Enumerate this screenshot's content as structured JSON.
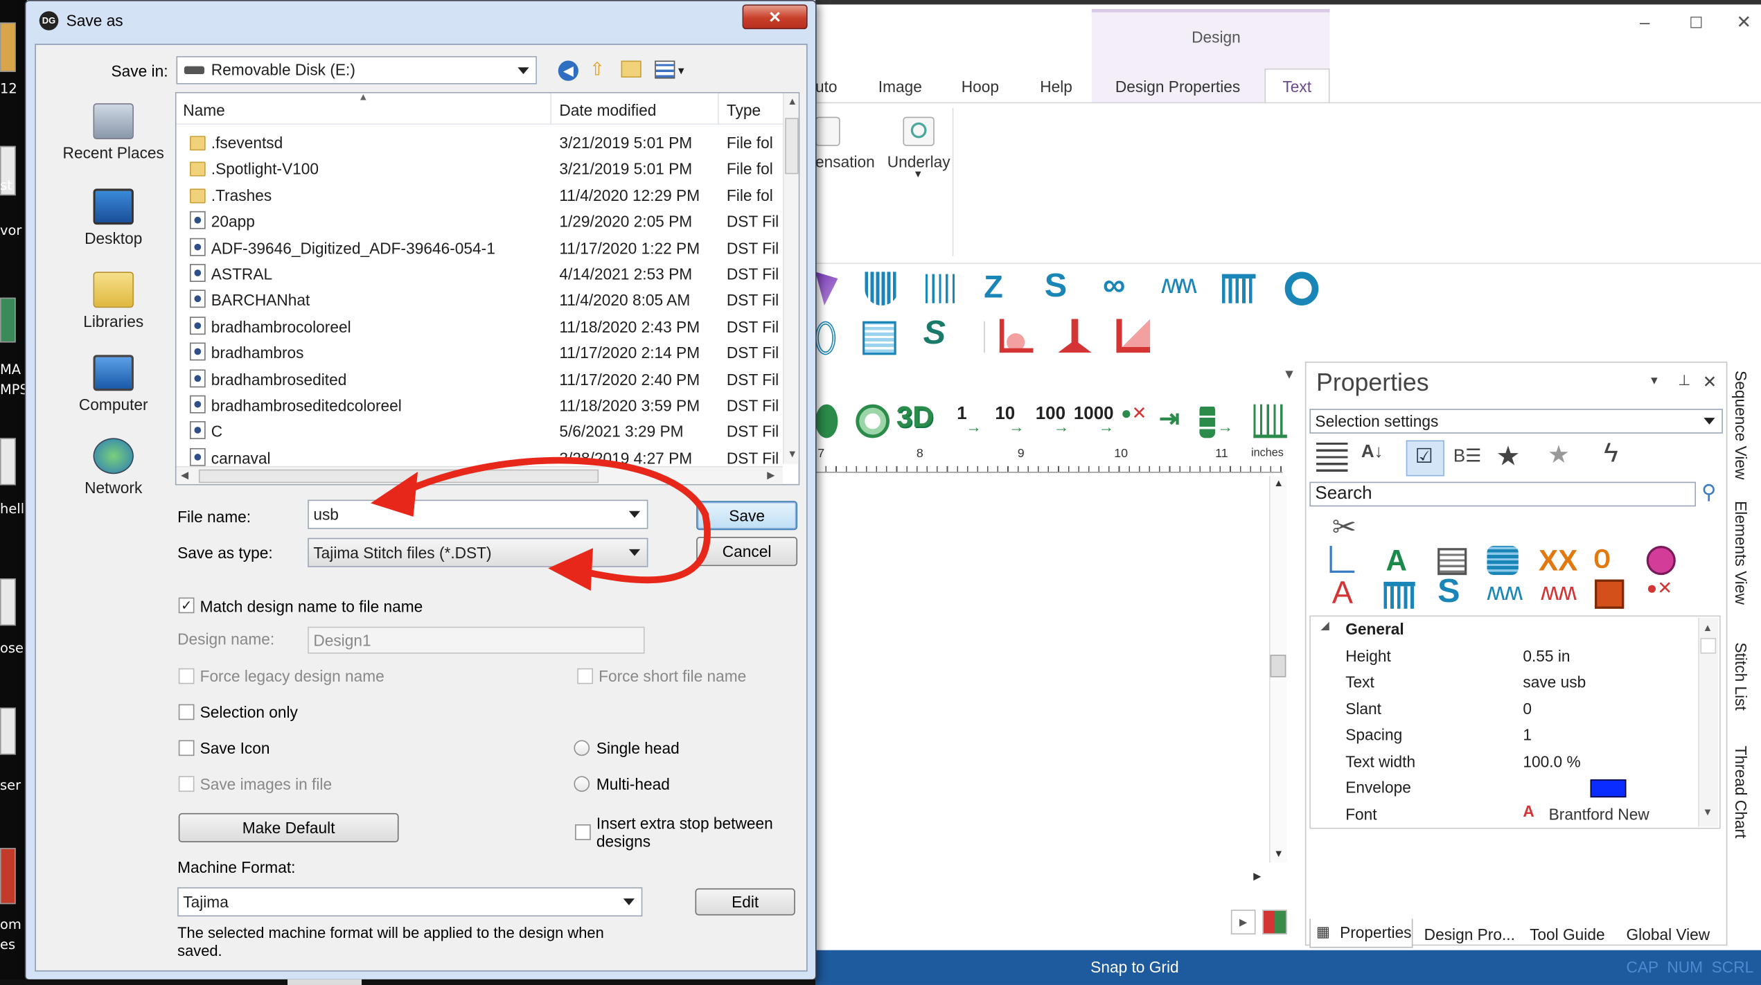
{
  "desktop": {
    "fragments": [
      "12",
      "st",
      "vor",
      "MA",
      "MPS",
      "hell",
      "ose",
      "ser",
      "om",
      "es"
    ]
  },
  "dialog": {
    "title": "Save as",
    "close_glyph": "✕",
    "save_in_label": "Save in:",
    "save_in_value": "Removable Disk (E:)",
    "places": [
      "Recent Places",
      "Desktop",
      "Libraries",
      "Computer",
      "Network"
    ],
    "columns": {
      "name": "Name",
      "date": "Date modified",
      "type": "Type"
    },
    "files": [
      {
        "name": ".fseventsd",
        "date": "3/21/2019 5:01 PM",
        "type": "File fol",
        "kind": "folder"
      },
      {
        "name": ".Spotlight-V100",
        "date": "3/21/2019 5:01 PM",
        "type": "File fol",
        "kind": "folder"
      },
      {
        "name": ".Trashes",
        "date": "11/4/2020 12:29 PM",
        "type": "File fol",
        "kind": "folder"
      },
      {
        "name": "20app",
        "date": "1/29/2020 2:05 PM",
        "type": "DST Fil",
        "kind": "doc"
      },
      {
        "name": "ADF-39646_Digitized_ADF-39646-054-1",
        "date": "11/17/2020 1:22 PM",
        "type": "DST Fil",
        "kind": "doc"
      },
      {
        "name": "ASTRAL",
        "date": "4/14/2021 2:53 PM",
        "type": "DST Fil",
        "kind": "doc"
      },
      {
        "name": "BARCHANhat",
        "date": "11/4/2020 8:05 AM",
        "type": "DST Fil",
        "kind": "doc"
      },
      {
        "name": "bradhambrocoloreel",
        "date": "11/18/2020 2:43 PM",
        "type": "DST Fil",
        "kind": "doc"
      },
      {
        "name": "bradhambros",
        "date": "11/17/2020 2:14 PM",
        "type": "DST Fil",
        "kind": "doc"
      },
      {
        "name": "bradhambrosedited",
        "date": "11/17/2020 2:40 PM",
        "type": "DST Fil",
        "kind": "doc"
      },
      {
        "name": "bradhambroseditedcoloreel",
        "date": "11/18/2020 3:59 PM",
        "type": "DST Fil",
        "kind": "doc"
      },
      {
        "name": "C",
        "date": "5/6/2021 3:29 PM",
        "type": "DST Fil",
        "kind": "doc"
      },
      {
        "name": "carnaval",
        "date": "3/28/2019 4:27 PM",
        "type": "DST Fil",
        "kind": "doc"
      }
    ],
    "file_name_label": "File name:",
    "file_name_value": "usb",
    "save_type_label": "Save as type:",
    "save_type_value": "Tajima Stitch files (*.DST)",
    "save_button": "Save",
    "cancel_button": "Cancel",
    "match_design_name": "Match design name to file name",
    "design_name_label": "Design name:",
    "design_name_value": "Design1",
    "force_legacy": "Force legacy design name",
    "force_short": "Force short file name",
    "selection_only": "Selection only",
    "save_icon": "Save Icon",
    "single_head": "Single head",
    "save_images": "Save images in file",
    "multi_head": "Multi-head",
    "make_default": "Make Default",
    "insert_stop_1": "Insert extra stop between",
    "insert_stop_2": "designs",
    "machine_format_label": "Machine Format:",
    "machine_format_value": "Tajima",
    "edit_button": "Edit",
    "footer_note_1": "The selected machine format will be applied to the design when",
    "footer_note_2": "saved."
  },
  "ribbon": {
    "context_group": "Design",
    "tabs": [
      "uto",
      "Image",
      "Hoop",
      "Help",
      "Design Properties",
      "Text"
    ],
    "buttons": [
      "ensation",
      "Underlay"
    ]
  },
  "toolbar": {
    "counts": [
      "1",
      "10",
      "100",
      "1000"
    ],
    "three_d": "3D"
  },
  "ruler": {
    "ticks": [
      "7",
      "8",
      "9",
      "10",
      "11"
    ],
    "unit": "inches"
  },
  "properties": {
    "title": "Properties",
    "selector": "Selection settings",
    "search": "Search",
    "section": "General",
    "rows": [
      {
        "label": "Height",
        "value": "0.55 in"
      },
      {
        "label": "Text",
        "value": "save usb"
      },
      {
        "label": "Slant",
        "value": "0"
      },
      {
        "label": "Spacing",
        "value": "1"
      },
      {
        "label": "Text width",
        "value": "100.0 %"
      },
      {
        "label": "Envelope",
        "value": ""
      },
      {
        "label": "Font",
        "value": "Brantford New"
      }
    ],
    "envelope_color": "#0a2cff",
    "bottom_tabs": [
      "Properties",
      "Design Pro...",
      "Tool Guide",
      "Global View"
    ],
    "side_tabs": [
      "Sequence View",
      "Elements View",
      "Stitch List",
      "Thread Chart"
    ]
  },
  "statusbar": {
    "center": "Snap to Grid",
    "indicators": "CAP  NUM  SCRL"
  },
  "colors": {
    "accent": "#1e5a9e",
    "arrow": "#e8271b",
    "teal": "#1a86b8",
    "red": "#d43434"
  }
}
